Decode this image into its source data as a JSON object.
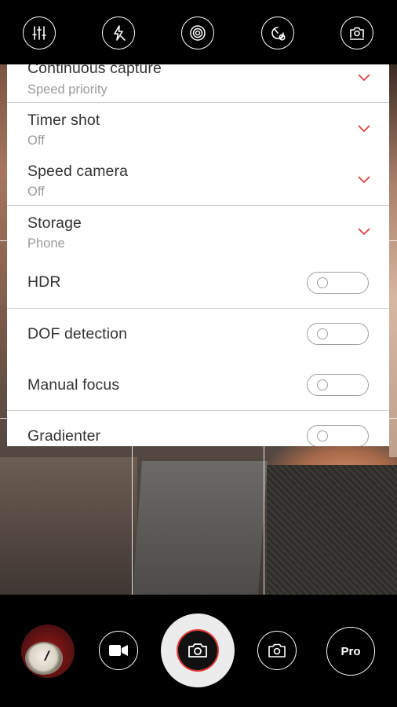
{
  "top_bar": {
    "icons": [
      "sliders-icon",
      "flash-off-icon",
      "beauty-filter-icon",
      "timer-off-icon",
      "switch-camera-icon"
    ]
  },
  "settings": {
    "continuous_capture": {
      "title": "Continuous capture",
      "value": "Speed priority"
    },
    "timer_shot": {
      "title": "Timer shot",
      "value": "Off"
    },
    "speed_camera": {
      "title": "Speed camera",
      "value": "Off"
    },
    "storage": {
      "title": "Storage",
      "value": "Phone"
    },
    "hdr": {
      "title": "HDR",
      "enabled": false
    },
    "dof_detection": {
      "title": "DOF detection",
      "enabled": false
    },
    "manual_focus": {
      "title": "Manual focus",
      "enabled": false
    },
    "gradienter": {
      "title": "Gradienter",
      "enabled": false
    }
  },
  "bottom_bar": {
    "pro_label": "Pro"
  },
  "colors": {
    "chevron": "#e04040",
    "shutter_ring": "#e23a3a",
    "panel_bg": "#ffffff",
    "text_primary": "#333333",
    "text_secondary": "#9a9a9a"
  }
}
